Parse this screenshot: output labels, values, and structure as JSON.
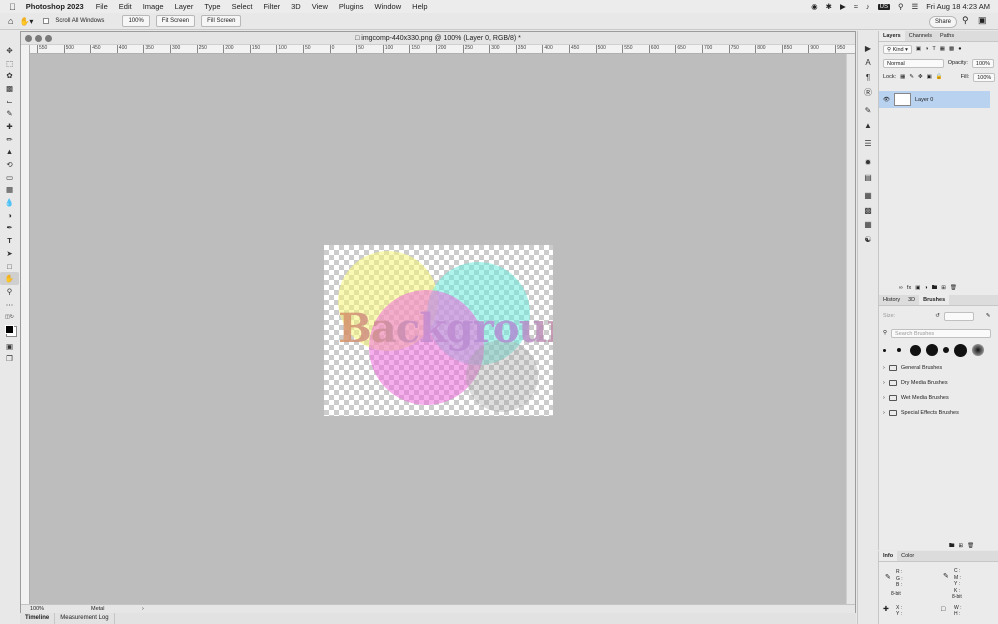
{
  "menubar": {
    "app_name": "Photoshop 2023",
    "items": [
      "File",
      "Edit",
      "Image",
      "Layer",
      "Type",
      "Select",
      "Filter",
      "3D",
      "View",
      "Plugins",
      "Window",
      "Help"
    ],
    "input_source": "US",
    "clock": "Fri Aug 18  4:23 AM"
  },
  "options": {
    "scroll_all_windows": "Scroll All Windows",
    "zoom_button": "100%",
    "fit_screen": "Fit Screen",
    "fill_screen": "Fill Screen",
    "share": "Share"
  },
  "document": {
    "title": "imgcomp-440x330.png @ 100% (Layer 0, RGB/8) *",
    "ruler_labels": [
      "550",
      "500",
      "450",
      "400",
      "350",
      "300",
      "250",
      "200",
      "150",
      "100",
      "50",
      "0",
      "50",
      "100",
      "150",
      "200",
      "250",
      "300",
      "350",
      "400",
      "450",
      "500",
      "550",
      "600",
      "650",
      "700",
      "750",
      "800",
      "850",
      "900",
      "950"
    ],
    "canvas_text": "Background",
    "status_zoom": "100%",
    "status_info": "Metal"
  },
  "bottom_tabs": [
    "Timeline",
    "Measurement Log"
  ],
  "layers_panel": {
    "tabs": [
      "Layers",
      "Channels",
      "Paths"
    ],
    "kind_label": "Kind",
    "blend_mode": "Normal",
    "opacity_label": "Opacity:",
    "opacity_value": "100%",
    "lock_label": "Lock:",
    "fill_label": "Fill:",
    "fill_value": "100%",
    "layer_name": "Layer 0"
  },
  "brushes_panel": {
    "tabs": [
      "History",
      "3D",
      "Brushes"
    ],
    "size_label": "Size:",
    "search_placeholder": "Search Brushes",
    "folders": [
      "General Brushes",
      "Dry Media Brushes",
      "Wet Media Brushes",
      "Special Effects Brushes"
    ]
  },
  "info_panel": {
    "tabs": [
      "Info",
      "Color"
    ],
    "r": "R :",
    "g": "G :",
    "b": "B :",
    "c": "C :",
    "m": "M :",
    "y": "Y :",
    "k": "K :",
    "bit_a": "8-bit",
    "bit_b": "8-bit",
    "x": "X :",
    "y_coord": "Y :",
    "w": "W :",
    "h": "H :"
  },
  "colors": {
    "selected_layer": "#b9d2f0",
    "canvas_bg": "#bdbdbd"
  }
}
